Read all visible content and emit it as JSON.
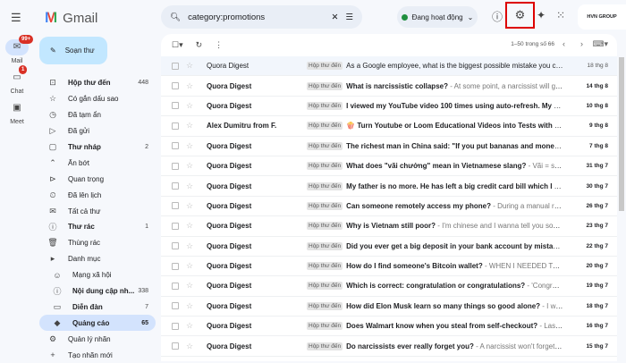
{
  "app": {
    "name": "Gmail"
  },
  "rail": [
    {
      "label": "Mail",
      "badge": "99+",
      "icon": "mail-icon"
    },
    {
      "label": "Chat",
      "badge": "1",
      "icon": "chat-icon"
    },
    {
      "label": "Meet",
      "badge": "",
      "icon": "video-icon"
    }
  ],
  "compose_label": "Soạn thư",
  "nav": [
    {
      "label": "Hộp thư đến",
      "count": "448",
      "icon": "inbox-icon",
      "glyph": "⊡",
      "bold": true
    },
    {
      "label": "Có gắn dấu sao",
      "count": "",
      "icon": "star-icon",
      "glyph": "☆"
    },
    {
      "label": "Đã tạm ẩn",
      "count": "",
      "icon": "clock-icon",
      "glyph": "◷"
    },
    {
      "label": "Đã gửi",
      "count": "",
      "icon": "send-icon",
      "glyph": "▷"
    },
    {
      "label": "Thư nháp",
      "count": "2",
      "icon": "draft-icon",
      "glyph": "▢",
      "bold": true
    },
    {
      "label": "Ẩn bớt",
      "count": "",
      "icon": "chevron-up-icon",
      "glyph": "⌃"
    },
    {
      "label": "Quan trọng",
      "count": "",
      "icon": "important-icon",
      "glyph": "⊳"
    },
    {
      "label": "Đã lên lịch",
      "count": "",
      "icon": "scheduled-icon",
      "glyph": "⏲"
    },
    {
      "label": "Tất cả thư",
      "count": "",
      "icon": "all-mail-icon",
      "glyph": "✉"
    },
    {
      "label": "Thư rác",
      "count": "1",
      "icon": "spam-icon",
      "glyph": "ⓘ",
      "bold": true
    },
    {
      "label": "Thùng rác",
      "count": "",
      "icon": "trash-icon",
      "glyph": "🗑"
    },
    {
      "label": "Danh mục",
      "count": "",
      "icon": "label-icon",
      "glyph": "▸"
    },
    {
      "label": "Mạng xã hội",
      "count": "",
      "icon": "social-icon",
      "glyph": "☺",
      "sub": true
    },
    {
      "label": "Nội dung cập nh...",
      "count": "338",
      "icon": "info-icon",
      "glyph": "ⓘ",
      "sub": true,
      "bold": true
    },
    {
      "label": "Diễn đàn",
      "count": "7",
      "icon": "forum-icon",
      "glyph": "▭",
      "sub": true,
      "bold": true
    },
    {
      "label": "Quảng cáo",
      "count": "65",
      "icon": "tag-icon",
      "glyph": "◆",
      "sub": true,
      "bold": true,
      "selected": true
    },
    {
      "label": "Quản lý nhãn",
      "count": "",
      "icon": "gear-icon",
      "glyph": "⚙"
    },
    {
      "label": "Tạo nhãn mới",
      "count": "",
      "icon": "plus-icon",
      "glyph": "+"
    }
  ],
  "search": {
    "value": "category:promotions"
  },
  "status": {
    "label": "Đang hoạt động"
  },
  "brand": "HVN GROUP",
  "pagination": "1–50 trong số 66",
  "label_tag": "Hộp thư đến",
  "emails": [
    {
      "from": "Quora Digest",
      "subject": "As a Google employee, what is the biggest possible mistake you co...",
      "snippet": "",
      "date": "18 thg 8",
      "read": true
    },
    {
      "from": "Quora Digest",
      "subject": "What is narcissistic collapse?",
      "snippet": " - At some point, a narcissist will go ...",
      "date": "14 thg 8"
    },
    {
      "from": "Quora Digest",
      "subject": "I viewed my YouTube video 100 times using auto-refresh. My vi...",
      "snippet": "",
      "date": "10 thg 8"
    },
    {
      "from": "Alex Dumitru from F.",
      "subject": "🍿 Turn Youtube or Loom Educational Videos into Tests with Sn...",
      "snippet": "",
      "date": "9 thg 8"
    },
    {
      "from": "Quora Digest",
      "subject": "The richest man in China said: \"If you put bananas and money i...",
      "snippet": "",
      "date": "7 thg 8"
    },
    {
      "from": "Quora Digest",
      "subject": "What does \"vãi chưởng\" mean in Vietnamese slang?",
      "snippet": " - Vãi = som...",
      "date": "31 thg 7"
    },
    {
      "from": "Quora Digest",
      "subject": "My father is no more. He has left a big credit card bill which I a...",
      "snippet": "",
      "date": "30 thg 7"
    },
    {
      "from": "Quora Digest",
      "subject": "Can someone remotely access my phone?",
      "snippet": " - During a manual revi...",
      "date": "26 thg 7"
    },
    {
      "from": "Quora Digest",
      "subject": "Why is Vietnam still poor?",
      "snippet": " - I'm chinese and I wanna tell you some...",
      "date": "23 thg 7"
    },
    {
      "from": "Quora Digest",
      "subject": "Did you ever get a big deposit in your bank account by mistake...",
      "snippet": "",
      "date": "22 thg 7"
    },
    {
      "from": "Quora Digest",
      "subject": "How do I find someone's Bitcoin wallet?",
      "snippet": " - WHEN I NEEDED TO TRACE...",
      "date": "20 thg 7"
    },
    {
      "from": "Quora Digest",
      "subject": "Which is correct: congratulation or congratulations?",
      "snippet": " - 'Congrat...",
      "date": "19 thg 7"
    },
    {
      "from": "Quora Digest",
      "subject": "How did Elon Musk learn so many things so good alone?",
      "snippet": " - I wor...",
      "date": "18 thg 7"
    },
    {
      "from": "Quora Digest",
      "subject": "Does Walmart know when you steal from self-checkout?",
      "snippet": " - Last ...",
      "date": "16 thg 7"
    },
    {
      "from": "Quora Digest",
      "subject": "Do narcissists ever really forget you?",
      "snippet": " - A narcissist won't forget y...",
      "date": "15 thg 7"
    }
  ]
}
